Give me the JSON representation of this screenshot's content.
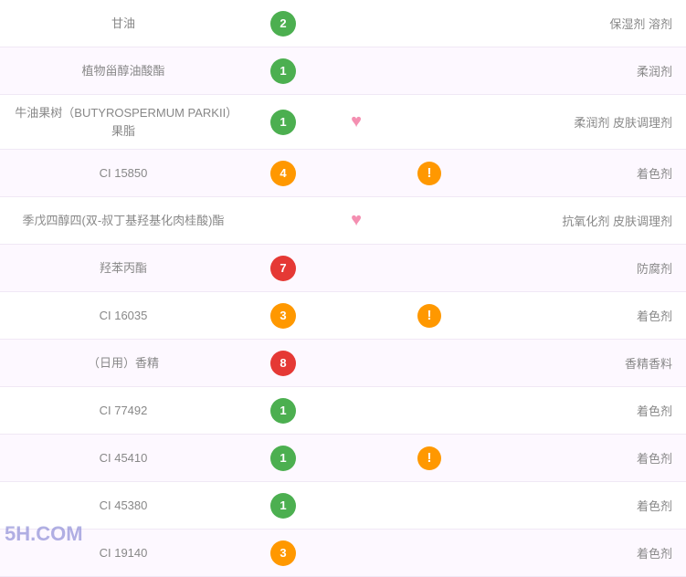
{
  "rows": [
    {
      "name": "甘油",
      "score": "2",
      "scoreColor": "green",
      "heart": false,
      "warning": false,
      "function": "保湿剂 溶剂"
    },
    {
      "name": "植物甾醇油酸酯",
      "score": "1",
      "scoreColor": "green",
      "heart": false,
      "warning": false,
      "function": "柔润剂"
    },
    {
      "name": "牛油果树（BUTYROSPERMUM PARKII）果脂",
      "score": "1",
      "scoreColor": "green",
      "heart": true,
      "warning": false,
      "function": "柔润剂 皮肤调理剂"
    },
    {
      "name": "CI 15850",
      "score": "4",
      "scoreColor": "orange",
      "heart": false,
      "warning": true,
      "function": "着色剂"
    },
    {
      "name": "季戊四醇四(双-叔丁基羟基化肉桂酸)酯",
      "score": "",
      "scoreColor": "",
      "heart": true,
      "warning": false,
      "function": "抗氧化剂 皮肤调理剂"
    },
    {
      "name": "羟苯丙酯",
      "score": "7",
      "scoreColor": "red",
      "heart": false,
      "warning": false,
      "function": "防腐剂"
    },
    {
      "name": "CI 16035",
      "score": "3",
      "scoreColor": "orange",
      "heart": false,
      "warning": true,
      "function": "着色剂"
    },
    {
      "name": "（日用）香精",
      "score": "8",
      "scoreColor": "red",
      "heart": false,
      "warning": false,
      "function": "香精香料"
    },
    {
      "name": "CI 77492",
      "score": "1",
      "scoreColor": "green",
      "heart": false,
      "warning": false,
      "function": "着色剂"
    },
    {
      "name": "CI 45410",
      "score": "1",
      "scoreColor": "green",
      "heart": false,
      "warning": true,
      "function": "着色剂"
    },
    {
      "name": "CI 45380",
      "score": "1",
      "scoreColor": "green",
      "heart": false,
      "warning": false,
      "function": "着色剂"
    },
    {
      "name": "CI 19140",
      "score": "3",
      "scoreColor": "orange",
      "heart": false,
      "warning": false,
      "function": "着色剂"
    }
  ],
  "watermark": "5H.COM"
}
